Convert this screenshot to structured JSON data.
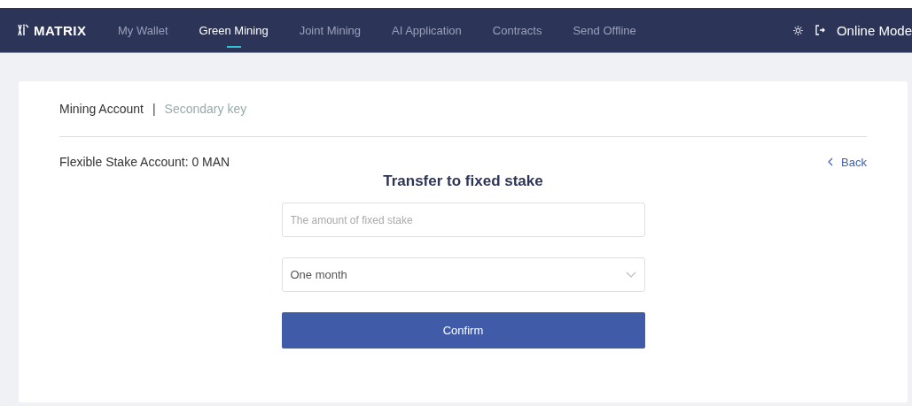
{
  "nav": {
    "logo": "MATRIX",
    "items": [
      {
        "label": "My Wallet",
        "selected": false
      },
      {
        "label": "Green Mining",
        "selected": true
      },
      {
        "label": "Joint Mining",
        "selected": false
      },
      {
        "label": "AI Application",
        "selected": false
      },
      {
        "label": "Contracts",
        "selected": false
      },
      {
        "label": "Send Offline",
        "selected": false
      }
    ],
    "mode": "Online Mode"
  },
  "tabs": {
    "items": [
      {
        "label": "Mining Account",
        "selected": true
      },
      {
        "label": "Secondary key",
        "selected": false
      }
    ],
    "separator": "|"
  },
  "account": "Flexible Stake Account: 0 MAN",
  "back": "Back",
  "form": {
    "title": "Transfer to fixed stake",
    "amount": {
      "placeholder": "The amount of fixed stake"
    },
    "period": {
      "value": "One month"
    },
    "confirm": "Confirm"
  }
}
